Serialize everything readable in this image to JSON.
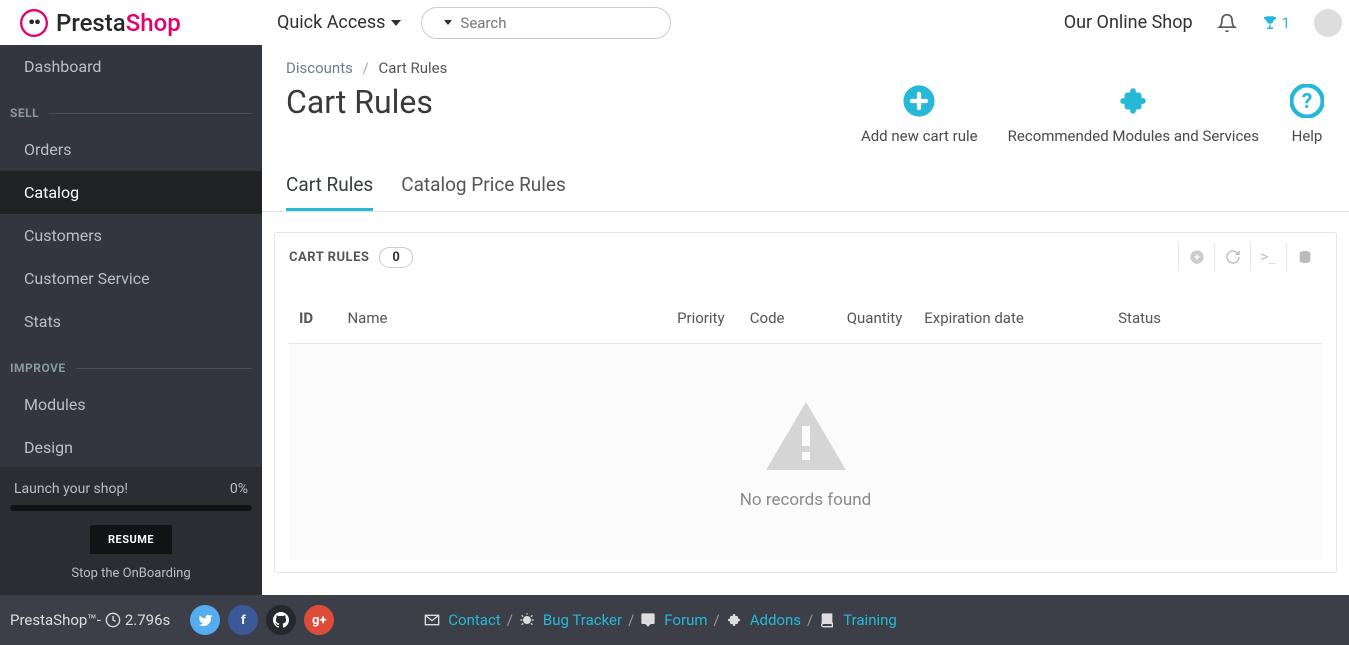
{
  "brand": {
    "presta": "Presta",
    "shop": "Shop"
  },
  "sidebar": {
    "dashboard": "Dashboard",
    "sections": {
      "sell": "SELL",
      "improve": "IMPROVE"
    },
    "sell_items": [
      "Orders",
      "Catalog",
      "Customers",
      "Customer Service",
      "Stats"
    ],
    "improve_items": [
      "Modules",
      "Design"
    ]
  },
  "onboard": {
    "launch": "Launch your shop!",
    "pct": "0%",
    "resume": "RESUME",
    "stop": "Stop the OnBoarding"
  },
  "topbar": {
    "quick_access": "Quick Access",
    "search_placeholder": "Search",
    "shop_name": "Our Online Shop",
    "trophy_count": "1"
  },
  "breadcrumb": {
    "parent": "Discounts",
    "current": "Cart Rules"
  },
  "page": {
    "title": "Cart Rules"
  },
  "actions": {
    "add": "Add new cart rule",
    "modules": "Recommended Modules and Services",
    "help": "Help"
  },
  "tabs": {
    "cart_rules": "Cart Rules",
    "catalog_rules": "Catalog Price Rules"
  },
  "panel": {
    "title": "CART RULES",
    "count": "0",
    "empty": "No records found"
  },
  "columns": {
    "id": "ID",
    "name": "Name",
    "priority": "Priority",
    "code": "Code",
    "qty": "Quantity",
    "exp": "Expiration date",
    "status": "Status"
  },
  "footer": {
    "brand": "PrestaShop™",
    "sep": " - ",
    "time": "2.796s",
    "links": {
      "contact": "Contact",
      "bug": "Bug Tracker",
      "forum": "Forum",
      "addons": "Addons",
      "training": "Training"
    }
  }
}
